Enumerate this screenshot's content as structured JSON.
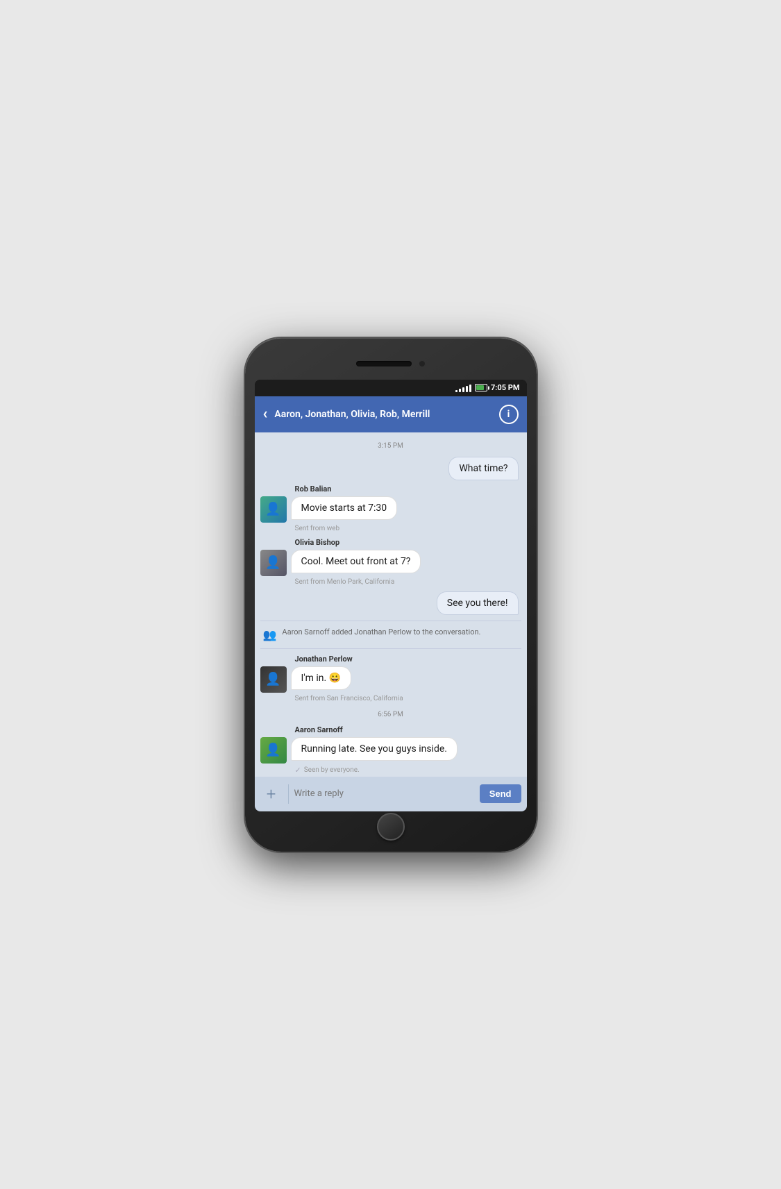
{
  "status_bar": {
    "time": "7:05 PM",
    "signal_bars": [
      3,
      5,
      7,
      9,
      11
    ],
    "battery_pct": 75
  },
  "header": {
    "back_label": "‹",
    "title": "Aaron, Jonathan, Olivia, Rob, Merrill",
    "info_label": "i"
  },
  "chat": {
    "timestamp1": "3:15 PM",
    "msg1": {
      "text": "What time?",
      "side": "right"
    },
    "sender2": "Rob Balian",
    "msg2": {
      "text": "Movie starts at 7:30",
      "sent_from": "Sent from web"
    },
    "sender3": "Olivia Bishop",
    "msg3": {
      "text": "Cool. Meet out front at 7?",
      "sent_from": "Sent from Menlo Park, California"
    },
    "msg4": {
      "text": "See you there!",
      "side": "right"
    },
    "system_msg": "Aaron Sarnoff added Jonathan Perlow to the conversation.",
    "sender5": "Jonathan Perlow",
    "msg5": {
      "text": "I'm in. 😀",
      "sent_from": "Sent from San Francisco, California"
    },
    "timestamp2": "6:56 PM",
    "sender6": "Aaron Sarnoff",
    "msg6": {
      "text": "Running late. See you guys inside.",
      "seen": "Seen by everyone."
    }
  },
  "input_bar": {
    "add_label": "+",
    "placeholder": "Write a reply",
    "send_label": "Send"
  }
}
